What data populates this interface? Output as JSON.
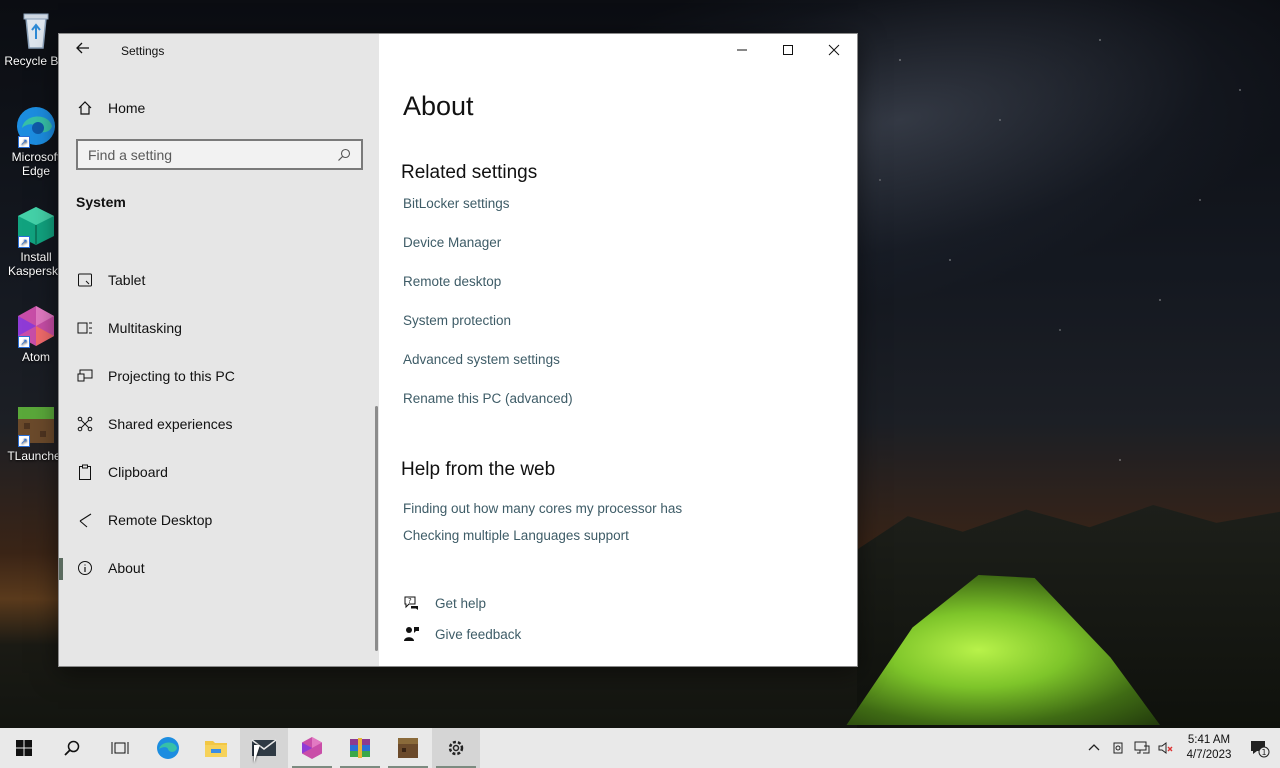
{
  "desktop": {
    "icons": [
      {
        "label": "Recycle Bin",
        "icon": "recycle-bin-icon"
      },
      {
        "label": "Microsoft Edge",
        "icon": "edge-icon"
      },
      {
        "label": "Install Kaspersky",
        "icon": "kaspersky-icon"
      },
      {
        "label": "Atom",
        "icon": "atom-icon"
      },
      {
        "label": "TLauncher",
        "icon": "tlauncher-icon"
      }
    ]
  },
  "window": {
    "title": "Settings",
    "home_label": "Home",
    "search_placeholder": "Find a setting",
    "section": "System",
    "nav": [
      {
        "label": "Tablet",
        "icon": "tablet-icon"
      },
      {
        "label": "Multitasking",
        "icon": "multitasking-icon"
      },
      {
        "label": "Projecting to this PC",
        "icon": "projecting-icon"
      },
      {
        "label": "Shared experiences",
        "icon": "shared-experiences-icon"
      },
      {
        "label": "Clipboard",
        "icon": "clipboard-icon"
      },
      {
        "label": "Remote Desktop",
        "icon": "remote-desktop-icon"
      },
      {
        "label": "About",
        "icon": "info-icon",
        "active": true
      }
    ]
  },
  "content": {
    "title": "About",
    "related_heading": "Related settings",
    "related_links": [
      "BitLocker settings",
      "Device Manager",
      "Remote desktop",
      "System protection",
      "Advanced system settings",
      "Rename this PC (advanced)"
    ],
    "web_heading": "Help from the web",
    "web_links": [
      "Finding out how many cores my processor has",
      "Checking multiple Languages support"
    ],
    "get_help": "Get help",
    "give_feedback": "Give feedback"
  },
  "taskbar": {
    "time": "5:41 AM",
    "date": "4/7/2023",
    "notification_count": "1"
  },
  "colors": {
    "accent": "#3e5c67",
    "sidebar_bg": "#e6e6e6",
    "taskbar_bg": "#e9e9e9"
  }
}
